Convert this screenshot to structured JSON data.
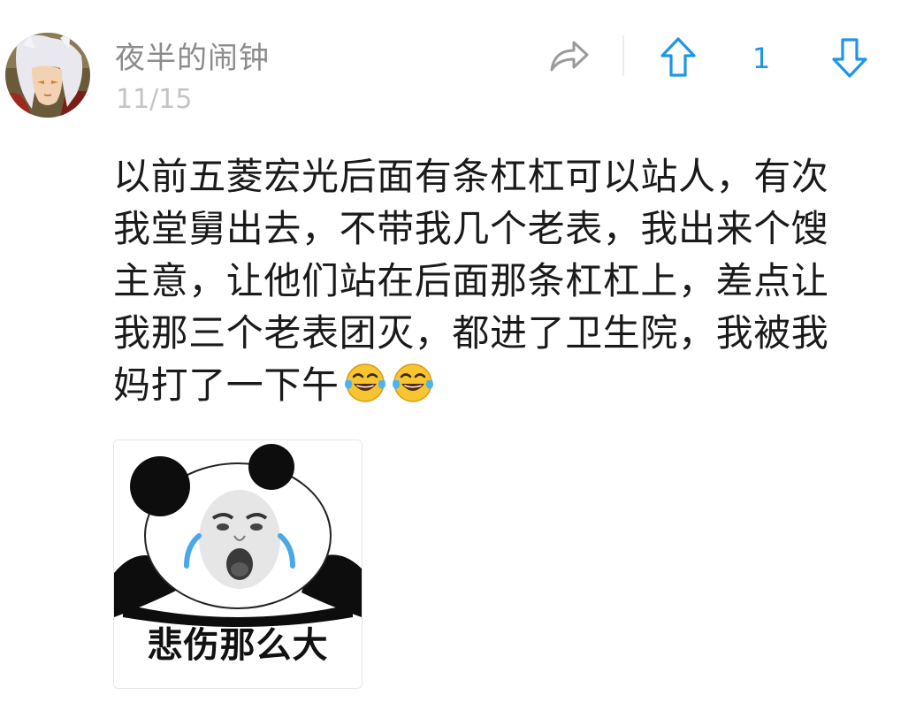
{
  "post": {
    "author": "夜半的闹钟",
    "date": "11/15",
    "avatar_icon": "anime-avatar",
    "content_lines": [
      "以前五菱宏光后面有条杠杠可以站人，有次",
      "我堂舅出去，不带我几个老表，我出来个馊",
      "主意，让他们站在后面那条杠杠上，差点让",
      "我那三个老表团灭，都进了卫生院，我被我",
      "妈打了一下午"
    ],
    "content_emojis": [
      "tears-of-joy-emoji",
      "tears-of-joy-emoji"
    ],
    "meme": {
      "icon": "crying-panda-meme",
      "caption": "悲伤那么大"
    }
  },
  "actions": {
    "share_icon": "share-icon",
    "upvote_icon": "upvote-arrow-icon",
    "vote_count": "1",
    "downvote_icon": "downvote-arrow-icon"
  },
  "colors": {
    "accent": "#1e96e6",
    "author": "#8c8c8c",
    "date": "#c4c4c4",
    "text": "#1a1a1a",
    "share_icon": "#9a9a9a"
  }
}
